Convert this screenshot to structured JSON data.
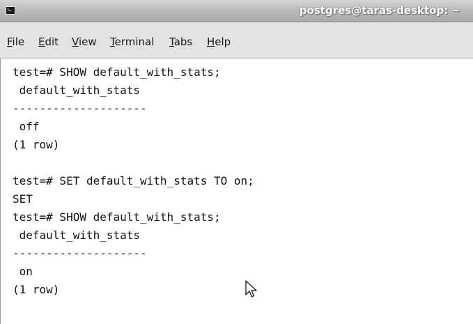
{
  "window": {
    "title": "postgres@taras-desktop: ~"
  },
  "menu": [
    {
      "mnemonic": "F",
      "rest": "ile"
    },
    {
      "mnemonic": "E",
      "rest": "dit"
    },
    {
      "mnemonic": "V",
      "rest": "iew"
    },
    {
      "mnemonic": "T",
      "rest": "erminal"
    },
    {
      "mnemonic": "T",
      "rest": "abs"
    },
    {
      "mnemonic": "H",
      "rest": "elp"
    }
  ],
  "terminal": {
    "lines": [
      "test=# SHOW default_with_stats;",
      " default_with_stats",
      "--------------------",
      " off",
      "(1 row)",
      "",
      "test=# SET default_with_stats TO on;",
      "SET",
      "test=# SHOW default_with_stats;",
      " default_with_stats",
      "--------------------",
      " on",
      "(1 row)"
    ]
  },
  "icons": {
    "app": "terminal-app-icon",
    "pointer": "mouse-pointer-icon"
  }
}
